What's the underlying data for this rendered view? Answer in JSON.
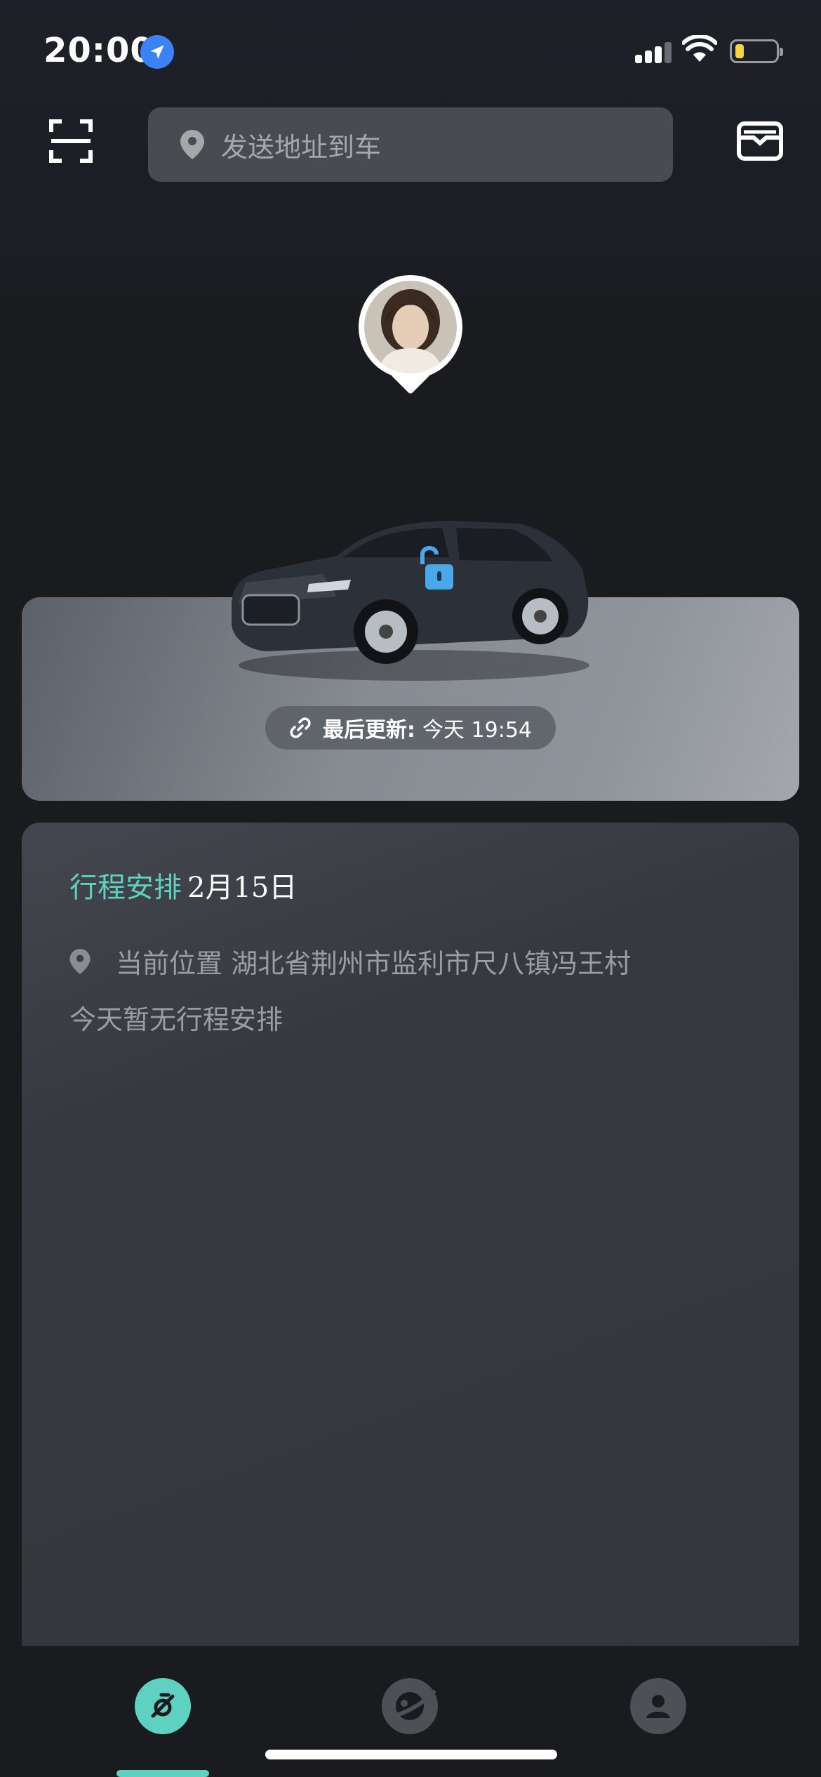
{
  "status_bar": {
    "time": "20:00",
    "icons": [
      "location-arrow-icon",
      "cellular-signal-icon",
      "wifi-icon",
      "battery-icon"
    ],
    "battery_color": "#f5d547"
  },
  "header": {
    "scan_icon": "scan-icon",
    "search": {
      "placeholder": "发送地址到车",
      "icon": "map-pin-icon"
    },
    "inbox_icon": "inbox-icon"
  },
  "avatar": {
    "icon": "user-avatar"
  },
  "car": {
    "lock_icon": "unlocked-padlock-icon",
    "lock_color": "#4aa8e8",
    "update_label": "最后更新:",
    "update_time": "今天 19:54",
    "link_icon": "link-icon"
  },
  "trip": {
    "title": "行程安排",
    "date": "2月15日",
    "location_label": "当前位置",
    "location_value": "湖北省荆州市监利市尺八镇冯王村",
    "empty_text": "今天暂无行程安排"
  },
  "bottom_nav": {
    "tabs": [
      {
        "icon": "car-home-icon",
        "active": true
      },
      {
        "icon": "planet-discover-icon",
        "active": false
      },
      {
        "icon": "profile-icon",
        "active": false
      }
    ],
    "accent": "#5ed1c0"
  }
}
